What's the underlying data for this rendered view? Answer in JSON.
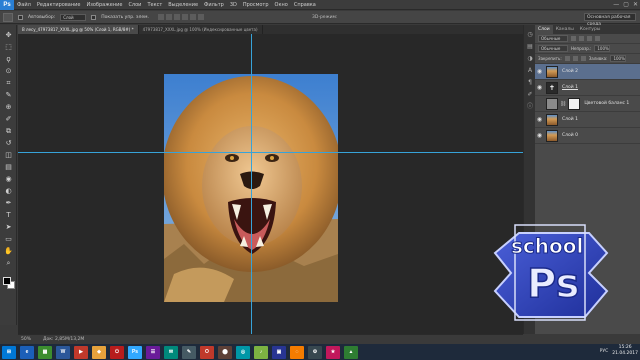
{
  "app": {
    "logo": "Ps"
  },
  "menu": [
    "Файл",
    "Редактирование",
    "Изображение",
    "Слои",
    "Текст",
    "Выделение",
    "Фильтр",
    "3D",
    "Просмотр",
    "Окно",
    "Справка"
  ],
  "options": {
    "autoselect_label": "Автовыбор:",
    "autoselect_value": "Слой",
    "show_controls_label": "Показать упр. элем.",
    "mode_3d_label": "3D-режим:",
    "workspace": "Основная рабочая среда"
  },
  "tabs": [
    {
      "label": "В лесу_47973817_XXXL.jpg @ 50% (Слой 1, RGB/8#) *",
      "active": true
    },
    {
      "label": "47973817_XXXL.jpg @ 100% (Индексированные цвета)",
      "active": false
    }
  ],
  "status": {
    "zoom": "50%",
    "doc": "Док: 2,85М/13,2М"
  },
  "icons": {
    "tools": [
      "move-icon",
      "marquee-icon",
      "lasso-icon",
      "quick-select-icon",
      "crop-icon",
      "eyedropper-icon",
      "healing-icon",
      "brush-icon",
      "clone-stamp-icon",
      "history-brush-icon",
      "eraser-icon",
      "gradient-icon",
      "blur-icon",
      "dodge-icon",
      "pen-icon",
      "type-icon",
      "path-select-icon",
      "shape-icon",
      "hand-icon",
      "zoom-icon"
    ],
    "tool_glyphs": [
      "✥",
      "⬚",
      "ϙ",
      "⊙",
      "⌗",
      "✎",
      "⊕",
      "✐",
      "⧉",
      "↺",
      "◫",
      "▤",
      "◉",
      "◐",
      "✒",
      "T",
      "➤",
      "▭",
      "✋",
      "⌕"
    ],
    "dock": [
      "history-icon",
      "properties-icon",
      "adjustments-icon",
      "character-icon",
      "paragraph-icon",
      "brush-panel-icon",
      "info-icon"
    ],
    "dock_glyphs": [
      "◷",
      "▤",
      "◑",
      "A",
      "¶",
      "✐",
      "ⓘ"
    ]
  },
  "panel": {
    "tabs": [
      "Слои",
      "Каналы",
      "Контуры"
    ],
    "kind_label": "Обычные",
    "blend_mode": "Обычные",
    "opacity_label": "Непрозр.:",
    "opacity_value": "100%",
    "lock_label": "Закрепить:",
    "fill_label": "Заливка:",
    "fill_value": "100%"
  },
  "layers": [
    {
      "name": "Слой 2",
      "thumb": "lion",
      "selected": true,
      "visible": true
    },
    {
      "name": "Слой 1",
      "thumb": "adjust",
      "selected": false,
      "visible": true,
      "underline": true
    },
    {
      "name": "Цветовой баланс 1",
      "thumb": "white",
      "selected": false,
      "visible": false
    },
    {
      "name": "Слой 1",
      "thumb": "lion",
      "selected": false,
      "visible": true
    },
    {
      "name": "Слой 0",
      "thumb": "lion",
      "selected": false,
      "visible": true
    }
  ],
  "watermark": {
    "line1": "school",
    "line2": "Ps"
  },
  "taskbar": {
    "buttons": [
      {
        "label": "⊞",
        "color": "#0078d7"
      },
      {
        "label": "e",
        "color": "#1b5fb8"
      },
      {
        "label": "▦",
        "color": "#3c8d2f"
      },
      {
        "label": "W",
        "color": "#2b579a"
      },
      {
        "label": "▶",
        "color": "#c0392b"
      },
      {
        "label": "◆",
        "color": "#e6a23c"
      },
      {
        "label": "⏻",
        "color": "#b71c1c"
      },
      {
        "label": "Ps",
        "color": "#31a8ff"
      },
      {
        "label": "☰",
        "color": "#6a1b9a"
      },
      {
        "label": "✉",
        "color": "#00897b"
      },
      {
        "label": "✎",
        "color": "#455a64"
      },
      {
        "label": "O",
        "color": "#c0392b"
      },
      {
        "label": "⬤",
        "color": "#5d4037"
      },
      {
        "label": "◎",
        "color": "#0097a7"
      },
      {
        "label": "♪",
        "color": "#7cb342"
      },
      {
        "label": "▣",
        "color": "#283593"
      },
      {
        "label": "◌",
        "color": "#f57c00"
      },
      {
        "label": "⚙",
        "color": "#37474f"
      },
      {
        "label": "★",
        "color": "#c2185b"
      },
      {
        "label": "▲",
        "color": "#2e7d32"
      }
    ],
    "lang": "РУС",
    "time": "15:26",
    "date": "21.04.2017"
  }
}
